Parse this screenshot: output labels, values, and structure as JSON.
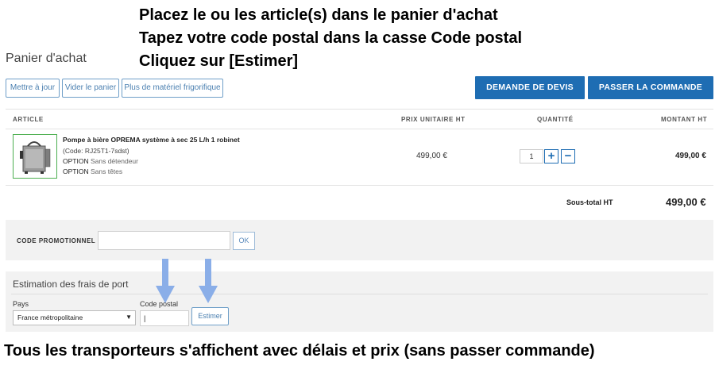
{
  "instructions": {
    "line1": "Placez le ou les article(s) dans le panier d'achat",
    "line2": "Tapez votre code postal dans la casse Code postal",
    "line3": "Cliquez sur [Estimer]",
    "bottom": "Tous les transporteurs s'affichent avec délais et prix (sans passer commande)"
  },
  "page": {
    "title": "Panier d'achat"
  },
  "toolbar": {
    "update_label": "Mettre à jour",
    "empty_label": "Vider le panier",
    "more_label": "Plus de matériel frigorifique",
    "quote_label": "DEMANDE DE DEVIS",
    "order_label": "PASSER LA COMMANDE"
  },
  "table": {
    "headers": {
      "article": "ARTICLE",
      "unit_price": "PRIX UNITAIRE HT",
      "quantity": "QUANTITÉ",
      "amount": "MONTANT HT"
    },
    "rows": [
      {
        "name": "Pompe à bière OPREMA système à sec 25 L/h 1 robinet",
        "code": "(Code: RJ25T1-7sdst)",
        "option1_key": "OPTION",
        "option1_value": "Sans détendeur",
        "option2_key": "OPTION",
        "option2_value": "Sans têtes",
        "unit_price": "499,00 €",
        "quantity": "1",
        "plus": "+",
        "minus": "−",
        "amount": "499,00 €"
      }
    ],
    "subtotal_label": "Sous-total HT",
    "subtotal_value": "499,00 €"
  },
  "promo": {
    "label": "CODE PROMOTIONNEL :",
    "value": "",
    "ok_label": "OK"
  },
  "shipping": {
    "title": "Estimation des frais de port",
    "country_label": "Pays",
    "country_value": "France métropolitaine",
    "postal_label": "Code postal",
    "postal_value": "|",
    "estimate_label": "Estimer"
  },
  "colors": {
    "primary": "#1e6db3",
    "arrow": "#8aaee8",
    "product_border": "#4caf50"
  }
}
